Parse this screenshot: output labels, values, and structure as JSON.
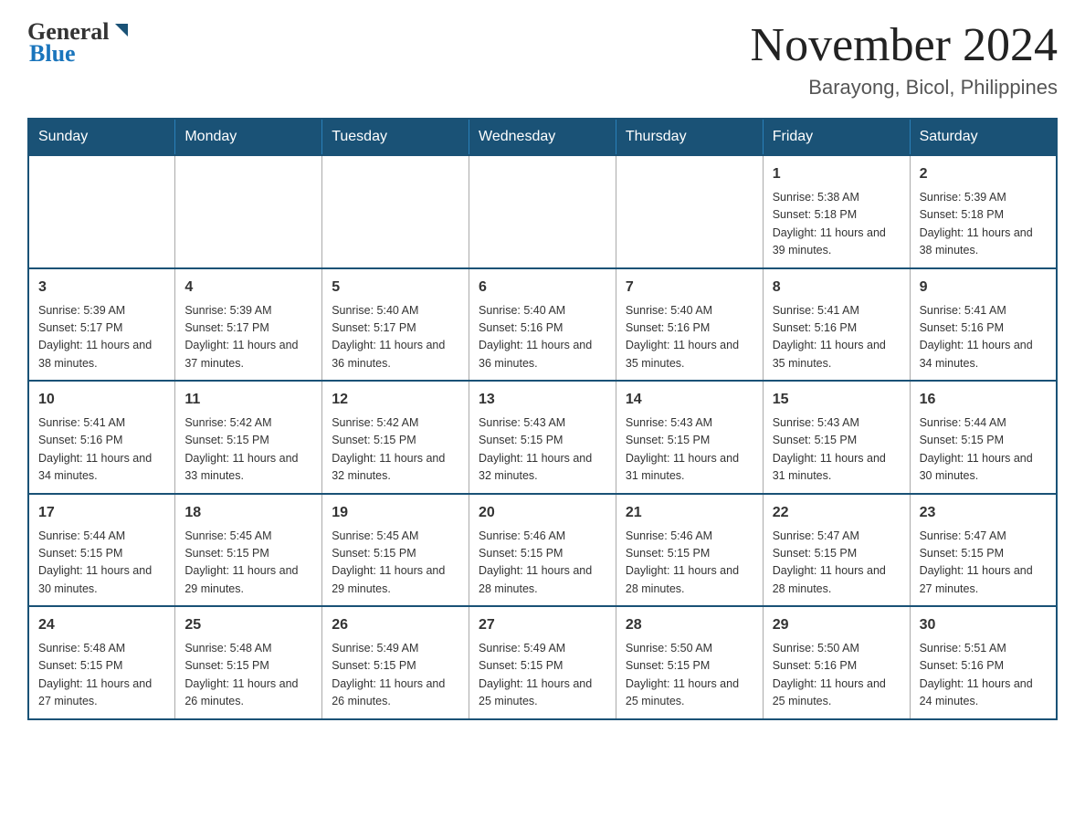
{
  "logo": {
    "general": "General",
    "blue": "Blue"
  },
  "title": "November 2024",
  "location": "Barayong, Bicol, Philippines",
  "days_of_week": [
    "Sunday",
    "Monday",
    "Tuesday",
    "Wednesday",
    "Thursday",
    "Friday",
    "Saturday"
  ],
  "weeks": [
    [
      {
        "day": "",
        "info": ""
      },
      {
        "day": "",
        "info": ""
      },
      {
        "day": "",
        "info": ""
      },
      {
        "day": "",
        "info": ""
      },
      {
        "day": "",
        "info": ""
      },
      {
        "day": "1",
        "info": "Sunrise: 5:38 AM\nSunset: 5:18 PM\nDaylight: 11 hours and 39 minutes."
      },
      {
        "day": "2",
        "info": "Sunrise: 5:39 AM\nSunset: 5:18 PM\nDaylight: 11 hours and 38 minutes."
      }
    ],
    [
      {
        "day": "3",
        "info": "Sunrise: 5:39 AM\nSunset: 5:17 PM\nDaylight: 11 hours and 38 minutes."
      },
      {
        "day": "4",
        "info": "Sunrise: 5:39 AM\nSunset: 5:17 PM\nDaylight: 11 hours and 37 minutes."
      },
      {
        "day": "5",
        "info": "Sunrise: 5:40 AM\nSunset: 5:17 PM\nDaylight: 11 hours and 36 minutes."
      },
      {
        "day": "6",
        "info": "Sunrise: 5:40 AM\nSunset: 5:16 PM\nDaylight: 11 hours and 36 minutes."
      },
      {
        "day": "7",
        "info": "Sunrise: 5:40 AM\nSunset: 5:16 PM\nDaylight: 11 hours and 35 minutes."
      },
      {
        "day": "8",
        "info": "Sunrise: 5:41 AM\nSunset: 5:16 PM\nDaylight: 11 hours and 35 minutes."
      },
      {
        "day": "9",
        "info": "Sunrise: 5:41 AM\nSunset: 5:16 PM\nDaylight: 11 hours and 34 minutes."
      }
    ],
    [
      {
        "day": "10",
        "info": "Sunrise: 5:41 AM\nSunset: 5:16 PM\nDaylight: 11 hours and 34 minutes."
      },
      {
        "day": "11",
        "info": "Sunrise: 5:42 AM\nSunset: 5:15 PM\nDaylight: 11 hours and 33 minutes."
      },
      {
        "day": "12",
        "info": "Sunrise: 5:42 AM\nSunset: 5:15 PM\nDaylight: 11 hours and 32 minutes."
      },
      {
        "day": "13",
        "info": "Sunrise: 5:43 AM\nSunset: 5:15 PM\nDaylight: 11 hours and 32 minutes."
      },
      {
        "day": "14",
        "info": "Sunrise: 5:43 AM\nSunset: 5:15 PM\nDaylight: 11 hours and 31 minutes."
      },
      {
        "day": "15",
        "info": "Sunrise: 5:43 AM\nSunset: 5:15 PM\nDaylight: 11 hours and 31 minutes."
      },
      {
        "day": "16",
        "info": "Sunrise: 5:44 AM\nSunset: 5:15 PM\nDaylight: 11 hours and 30 minutes."
      }
    ],
    [
      {
        "day": "17",
        "info": "Sunrise: 5:44 AM\nSunset: 5:15 PM\nDaylight: 11 hours and 30 minutes."
      },
      {
        "day": "18",
        "info": "Sunrise: 5:45 AM\nSunset: 5:15 PM\nDaylight: 11 hours and 29 minutes."
      },
      {
        "day": "19",
        "info": "Sunrise: 5:45 AM\nSunset: 5:15 PM\nDaylight: 11 hours and 29 minutes."
      },
      {
        "day": "20",
        "info": "Sunrise: 5:46 AM\nSunset: 5:15 PM\nDaylight: 11 hours and 28 minutes."
      },
      {
        "day": "21",
        "info": "Sunrise: 5:46 AM\nSunset: 5:15 PM\nDaylight: 11 hours and 28 minutes."
      },
      {
        "day": "22",
        "info": "Sunrise: 5:47 AM\nSunset: 5:15 PM\nDaylight: 11 hours and 28 minutes."
      },
      {
        "day": "23",
        "info": "Sunrise: 5:47 AM\nSunset: 5:15 PM\nDaylight: 11 hours and 27 minutes."
      }
    ],
    [
      {
        "day": "24",
        "info": "Sunrise: 5:48 AM\nSunset: 5:15 PM\nDaylight: 11 hours and 27 minutes."
      },
      {
        "day": "25",
        "info": "Sunrise: 5:48 AM\nSunset: 5:15 PM\nDaylight: 11 hours and 26 minutes."
      },
      {
        "day": "26",
        "info": "Sunrise: 5:49 AM\nSunset: 5:15 PM\nDaylight: 11 hours and 26 minutes."
      },
      {
        "day": "27",
        "info": "Sunrise: 5:49 AM\nSunset: 5:15 PM\nDaylight: 11 hours and 25 minutes."
      },
      {
        "day": "28",
        "info": "Sunrise: 5:50 AM\nSunset: 5:15 PM\nDaylight: 11 hours and 25 minutes."
      },
      {
        "day": "29",
        "info": "Sunrise: 5:50 AM\nSunset: 5:16 PM\nDaylight: 11 hours and 25 minutes."
      },
      {
        "day": "30",
        "info": "Sunrise: 5:51 AM\nSunset: 5:16 PM\nDaylight: 11 hours and 24 minutes."
      }
    ]
  ]
}
